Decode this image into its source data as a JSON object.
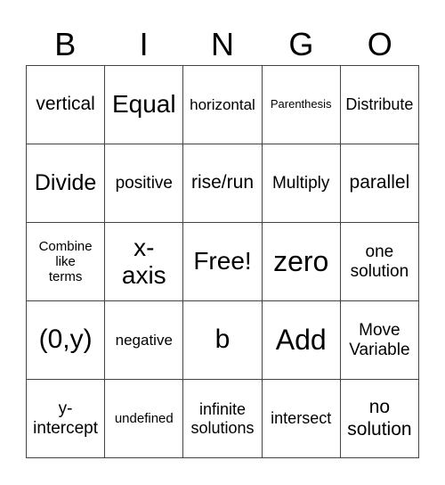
{
  "header": {
    "letters": [
      "B",
      "I",
      "N",
      "G",
      "O"
    ]
  },
  "grid": {
    "rows": [
      [
        "vertical",
        "Equal",
        "horizontal",
        "Parenthesis",
        "Distribute"
      ],
      [
        "Divide",
        "positive",
        "rise/run",
        "Multiply",
        "parallel"
      ],
      [
        "Combine like terms",
        "x-axis",
        "Free!",
        "zero",
        "one solution"
      ],
      [
        "(0,y)",
        "negative",
        "b",
        "Add",
        "Move Variable"
      ],
      [
        "y-intercept",
        "undefined",
        "infinite solutions",
        "intersect",
        "no solution"
      ]
    ]
  }
}
